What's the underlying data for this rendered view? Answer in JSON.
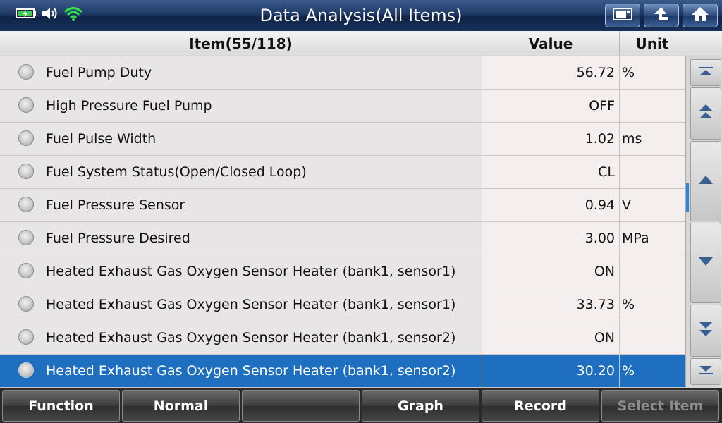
{
  "header": {
    "title": "Data Analysis(All Items)"
  },
  "columns": {
    "item": "Item(55/118)",
    "value": "Value",
    "unit": "Unit"
  },
  "rows": [
    {
      "label": "Fuel Pump Duty",
      "value": "56.72",
      "unit": "%"
    },
    {
      "label": "High Pressure Fuel Pump",
      "value": "OFF",
      "unit": ""
    },
    {
      "label": "Fuel Pulse Width",
      "value": "1.02",
      "unit": "ms"
    },
    {
      "label": "Fuel System Status(Open/Closed Loop)",
      "value": "CL",
      "unit": ""
    },
    {
      "label": "Fuel Pressure Sensor",
      "value": "0.94",
      "unit": "V"
    },
    {
      "label": "Fuel Pressure Desired",
      "value": "3.00",
      "unit": "MPa"
    },
    {
      "label": "Heated Exhaust Gas Oxygen Sensor Heater (bank1, sensor1)",
      "value": "ON",
      "unit": ""
    },
    {
      "label": "Heated Exhaust Gas Oxygen Sensor Heater (bank1, sensor1)",
      "value": "33.73",
      "unit": "%"
    },
    {
      "label": "Heated Exhaust Gas Oxygen Sensor Heater (bank1, sensor2)",
      "value": "ON",
      "unit": ""
    },
    {
      "label": "Heated Exhaust Gas Oxygen Sensor Heater (bank1, sensor2)",
      "value": "30.20",
      "unit": "%"
    }
  ],
  "selected_row": 9,
  "footer": {
    "function": "Function",
    "normal": "Normal",
    "empty": "",
    "graph": "Graph",
    "record": "Record",
    "select_item": "Select Item"
  },
  "colors": {
    "selected_row": "#1e6fc0",
    "wifi": "#2ee04a",
    "battery": "#3ad04a"
  },
  "icons": {
    "status": [
      "battery-charging-icon",
      "speaker-icon",
      "wifi-icon"
    ],
    "title_buttons": [
      "screenshot-icon",
      "back-arrow-icon",
      "home-icon"
    ],
    "scroll_buttons": [
      "scroll-top-icon",
      "page-up-icon",
      "line-up-icon",
      "line-down-icon",
      "page-down-icon",
      "scroll-bottom-icon"
    ]
  }
}
